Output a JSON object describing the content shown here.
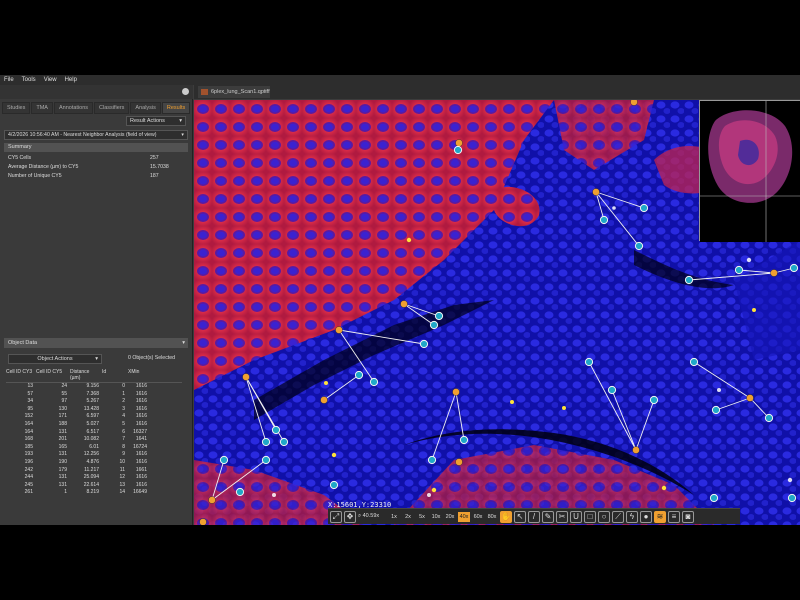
{
  "menu": [
    "File",
    "Tools",
    "View",
    "Help"
  ],
  "left_tabs": [
    "Studies",
    "TMA",
    "Annotations",
    "Classifiers",
    "Analysis",
    "Results"
  ],
  "active_tab": "Results",
  "result_actions_label": "Result Actions",
  "analysis_selector": "4/2/2026 10:56:40 AM - Nearest Neighbor Analysis (field of view)",
  "summary": {
    "title": "Summary",
    "rows": [
      {
        "label": "CY5 Cells",
        "value": "257"
      },
      {
        "label": "Average Distance (µm) to CY5",
        "value": "15.7038"
      },
      {
        "label": "Number of Unique CY5",
        "value": "187"
      }
    ]
  },
  "object_data": {
    "title": "Object Data",
    "actions_label": "Object Actions",
    "selected_text": "0 Object(s) Selected",
    "headers": [
      "Cell ID CY3",
      "Cell ID CY5",
      "Distance (µm)",
      "Id",
      "XMin"
    ],
    "rows": [
      [
        "13",
        "24",
        "9.156",
        "0",
        "1616"
      ],
      [
        "57",
        "55",
        "7.368",
        "1",
        "1616"
      ],
      [
        "34",
        "97",
        "5.267",
        "2",
        "1616"
      ],
      [
        "95",
        "130",
        "13.428",
        "3",
        "1616"
      ],
      [
        "152",
        "171",
        "6.597",
        "4",
        "1616"
      ],
      [
        "164",
        "188",
        "5.027",
        "5",
        "1616"
      ],
      [
        "164",
        "131",
        "6.517",
        "6",
        "16327"
      ],
      [
        "168",
        "201",
        "10.082",
        "7",
        "1641"
      ],
      [
        "185",
        "165",
        "6.01",
        "8",
        "16724"
      ],
      [
        "193",
        "131",
        "12.256",
        "9",
        "1616"
      ],
      [
        "196",
        "190",
        "4.876",
        "10",
        "1616"
      ],
      [
        "242",
        "179",
        "11.217",
        "11",
        "1661"
      ],
      [
        "244",
        "131",
        "25.094",
        "12",
        "1616"
      ],
      [
        "245",
        "131",
        "22.614",
        "13",
        "1616"
      ],
      [
        "261",
        "1",
        "8.219",
        "14",
        "16649"
      ]
    ]
  },
  "viewer_tab": "6plex_lung_Scan1.qptiff",
  "coordinates": "X:15601,Y:23310",
  "zoom_readout": "40.59x",
  "zoom_levels": [
    "1x",
    "2x",
    "5x",
    "10x",
    "20x",
    "40x",
    "60x",
    "80x"
  ],
  "active_zoom": "40x",
  "colors": {
    "accent": "#f0a030",
    "panel": "#3a3a3a",
    "tissue_red": "#d8283f",
    "nuclei_blue": "#1a1ad0"
  },
  "icons": {
    "left": [
      "fit-icon",
      "expand-icon"
    ],
    "tools": [
      "hand-icon",
      "pointer-icon",
      "brush-icon",
      "pen-icon",
      "scissors-icon",
      "magnet-icon",
      "square-icon",
      "circle-icon",
      "ruler-icon",
      "lightning-icon",
      "pin-icon",
      "layers-icon",
      "list-icon",
      "camera-icon"
    ]
  }
}
